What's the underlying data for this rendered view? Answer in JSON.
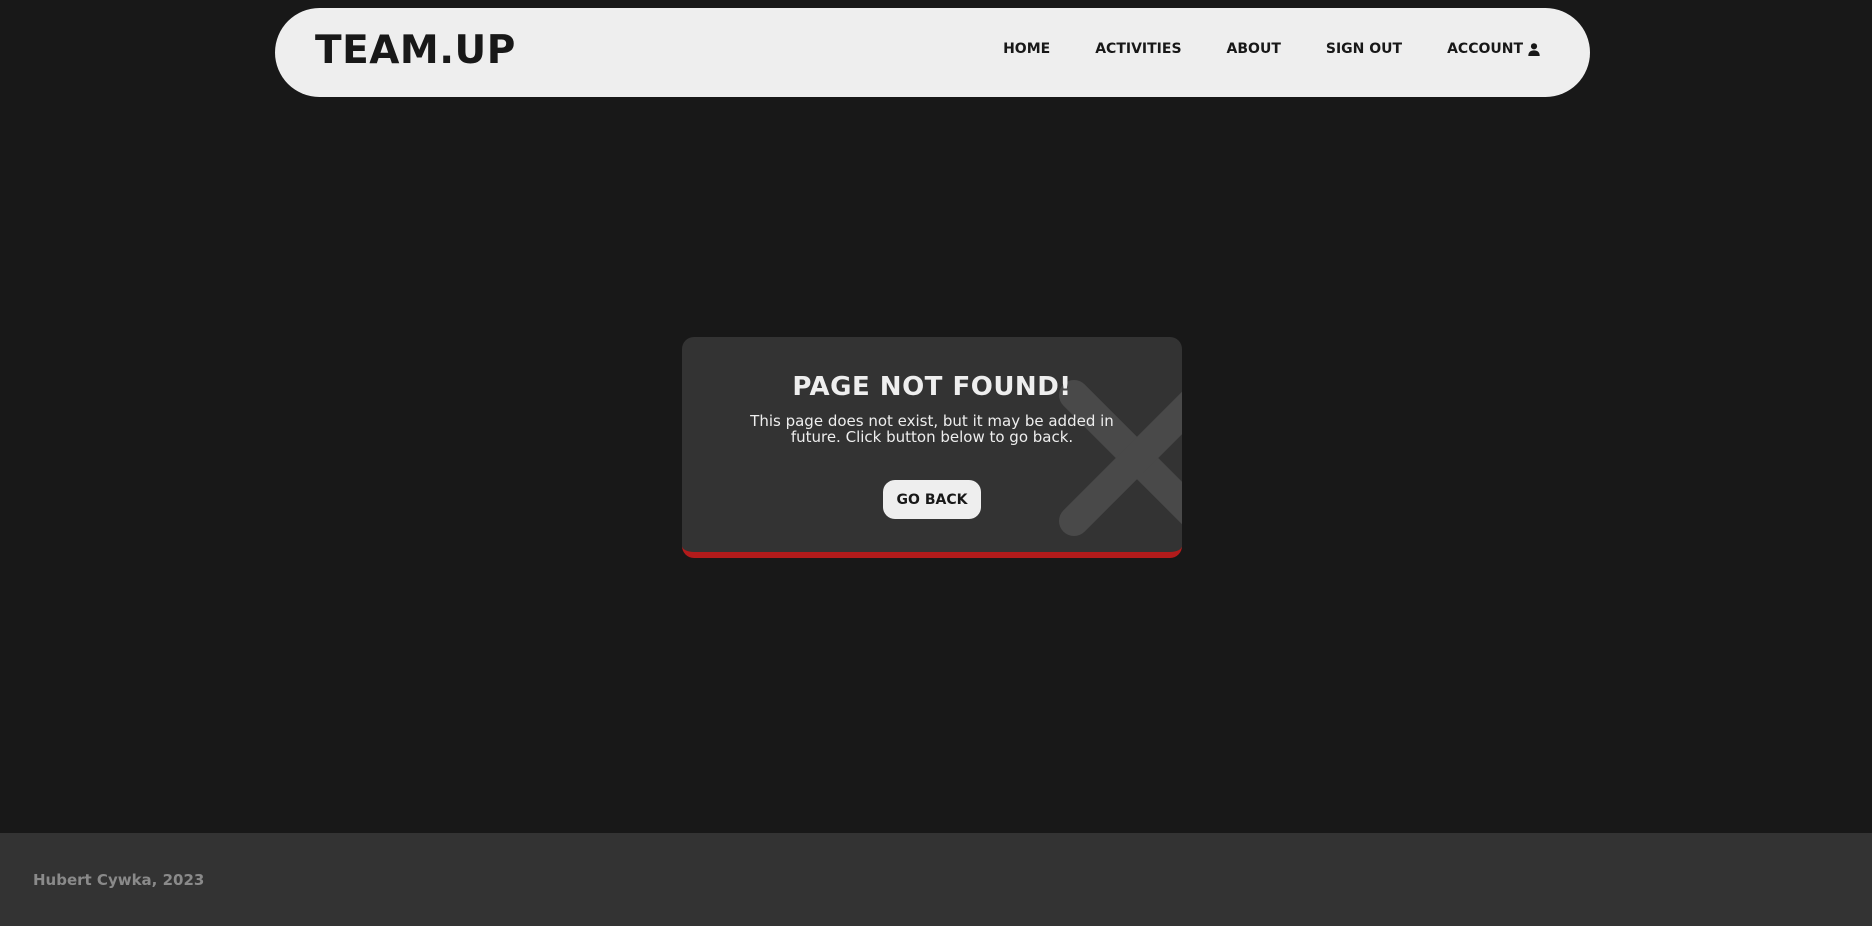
{
  "navbar": {
    "logo": "TEAM.UP",
    "links": [
      {
        "label": "HOME"
      },
      {
        "label": "ACTIVITIES"
      },
      {
        "label": "ABOUT"
      },
      {
        "label": "SIGN OUT"
      },
      {
        "label": "ACCOUNT",
        "icon": "user-icon"
      }
    ]
  },
  "card": {
    "title": "PAGE NOT FOUND!",
    "text": "This page does not exist, but it may be added in future. Click button below to go back.",
    "button_label": "GO BACK",
    "icon": "close-icon",
    "accent_color": "#b21b1b"
  },
  "footer": {
    "text": "Hubert Cywka, 2023"
  },
  "colors": {
    "background": "#181818",
    "surface": "#333333",
    "light": "#eeeeee",
    "accent": "#b21b1b"
  }
}
